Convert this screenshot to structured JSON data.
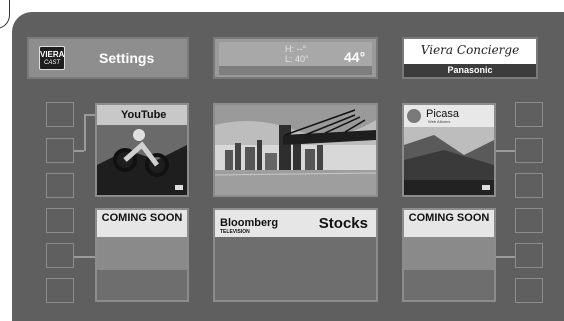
{
  "settings_tile": {
    "logo_main": "VIERA",
    "logo_sub": "CAST",
    "label": "Settings"
  },
  "weather": {
    "high": "H:  --°",
    "low": "L:  40°",
    "temp": "44°"
  },
  "concierge": {
    "title": "Viera Concierge",
    "brand": "Panasonic"
  },
  "apps": {
    "youtube": {
      "name": "YouTube"
    },
    "picasa": {
      "name": "Picasa",
      "tagline": "Web Albums"
    }
  },
  "coming_soon": {
    "left": "COMING SOON",
    "right": "COMING SOON"
  },
  "bloomberg": {
    "name": "Bloomberg",
    "sub": "TELEVISION",
    "label": "Stocks"
  },
  "colors": {
    "panel": "#5f5f5f",
    "tile": "#8e8e8e",
    "youtube_red": "#cc2a2a"
  }
}
